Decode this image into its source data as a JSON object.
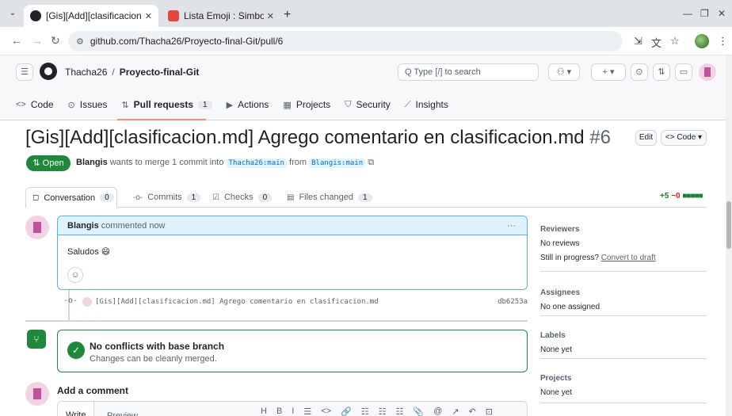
{
  "browser": {
    "tabs": [
      {
        "title": "[Gis][Add][clasificacion.m",
        "favicon_color": "#1f2328"
      },
      {
        "title": "Lista Emoji : Simbolos en",
        "favicon_color": "#e8453c"
      }
    ],
    "url": "github.com/Thacha26/Proyecto-final-Git/pull/6"
  },
  "header": {
    "owner": "Thacha26",
    "separator": "/",
    "repo": "Proyecto-final-Git",
    "search_placeholder": "Type / to search",
    "search_label": "Q Type [/] to search"
  },
  "repo_nav": [
    {
      "label": "Code",
      "icon": "<>"
    },
    {
      "label": "Issues",
      "icon": "⊙"
    },
    {
      "label": "Pull requests",
      "icon": "⇅",
      "count": "1"
    },
    {
      "label": "Actions",
      "icon": "▶"
    },
    {
      "label": "Projects",
      "icon": "▦"
    },
    {
      "label": "Security",
      "icon": "⛉"
    },
    {
      "label": "Insights",
      "icon": "⟋"
    }
  ],
  "pr": {
    "title": "[Gis][Add][clasificacion.md] Agrego comentario en clasificacion.md",
    "number": "#6",
    "edit_label": "Edit",
    "code_label": "<> Code ▾",
    "state": "Open",
    "author": "Blangis",
    "meta_text": "wants to merge 1 commit into",
    "base_branch": "Thacha26:main",
    "from_text": "from",
    "head_branch": "Blangis:main"
  },
  "pr_tabs": [
    {
      "label": "Conversation",
      "count": "0",
      "icon": "◻"
    },
    {
      "label": "Commits",
      "count": "1",
      "icon": "-o-"
    },
    {
      "label": "Checks",
      "count": "0",
      "icon": "☑"
    },
    {
      "label": "Files changed",
      "count": "1",
      "icon": "▤"
    }
  ],
  "diffstat": {
    "add": "+5",
    "del": "−0",
    "bars": "■■■■■"
  },
  "comment": {
    "author": "Blangis",
    "when": "commented now",
    "body": "Saludos 😄",
    "menu": "···"
  },
  "commit": {
    "message": "[Gis][Add][clasificacion.md] Agrego comentario en clasificacion.md",
    "sha": "db6253a"
  },
  "merge": {
    "title": "No conflicts with base branch",
    "subtitle": "Changes can be cleanly merged."
  },
  "new_comment": {
    "heading": "Add a comment",
    "write_tab": "Write",
    "preview_tab": "Preview",
    "toolbar": [
      "H",
      "B",
      "I",
      "☰",
      "<>",
      "🔗",
      "☷",
      "☷",
      "☷",
      "📎",
      "@",
      "↗",
      "↶",
      "⊡"
    ]
  },
  "sidebar": {
    "reviewers": {
      "heading": "Reviewers",
      "value": "No reviews",
      "progress": "Still in progress?",
      "link": "Convert to draft"
    },
    "assignees": {
      "heading": "Assignees",
      "value": "No one assigned"
    },
    "labels": {
      "heading": "Labels",
      "value": "None yet"
    },
    "projects": {
      "heading": "Projects",
      "value": "None yet"
    }
  },
  "colors": {
    "accent_green": "#1f883d",
    "link_blue": "#0969da",
    "tab_underline": "#fd8c73"
  }
}
